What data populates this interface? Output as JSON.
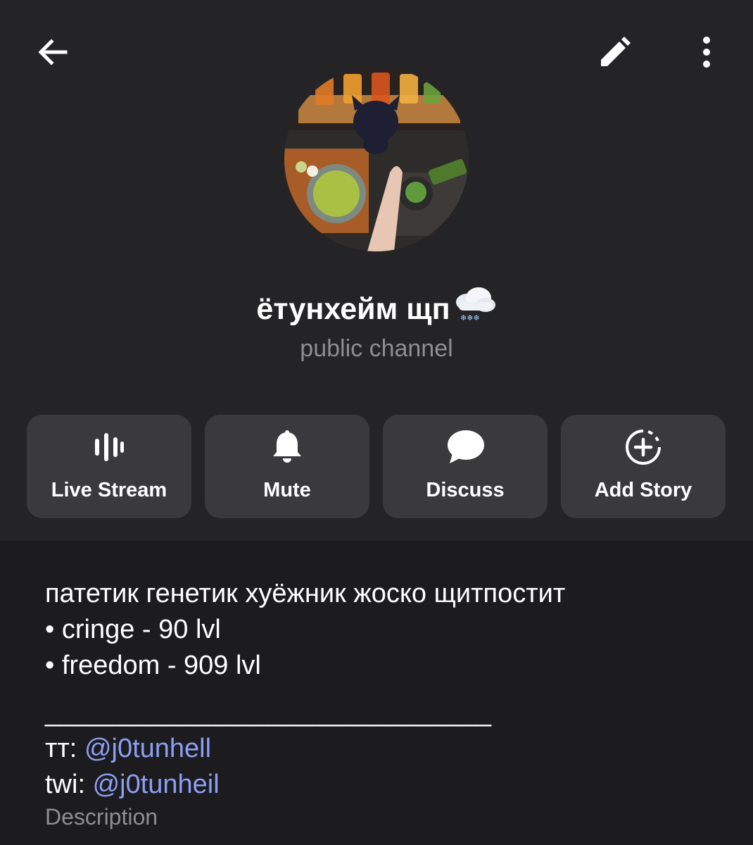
{
  "topbar": {
    "back_icon": "arrow-left-icon",
    "edit_icon": "pencil-icon",
    "more_icon": "more-vertical-icon"
  },
  "channel": {
    "name": "ётунхейм щп",
    "name_emoji": "cloud-with-snow-icon",
    "type_label": "public channel"
  },
  "actions": [
    {
      "label": "Live Stream",
      "icon": "live-stream-icon"
    },
    {
      "label": "Mute",
      "icon": "bell-icon"
    },
    {
      "label": "Discuss",
      "icon": "chat-bubble-icon"
    },
    {
      "label": "Add Story",
      "icon": "add-story-icon"
    }
  ],
  "about": {
    "line1": "патетик генетик хуёжник жоско щитпостит",
    "line2": "• cringe - 90 lvl",
    "line3": "• freedom - 909 lvl",
    "separator": "______________________________",
    "tt_prefix": "тт: ",
    "tt_handle": "@j0tunhell",
    "twi_prefix": "twi: ",
    "twi_handle": "@j0tunheil",
    "label": "Description"
  },
  "colors": {
    "background": "#1c1c1e",
    "header": "#242426",
    "button": "#3a3a3c",
    "link": "#8c9ef5",
    "secondary_text": "#8e8e93"
  }
}
